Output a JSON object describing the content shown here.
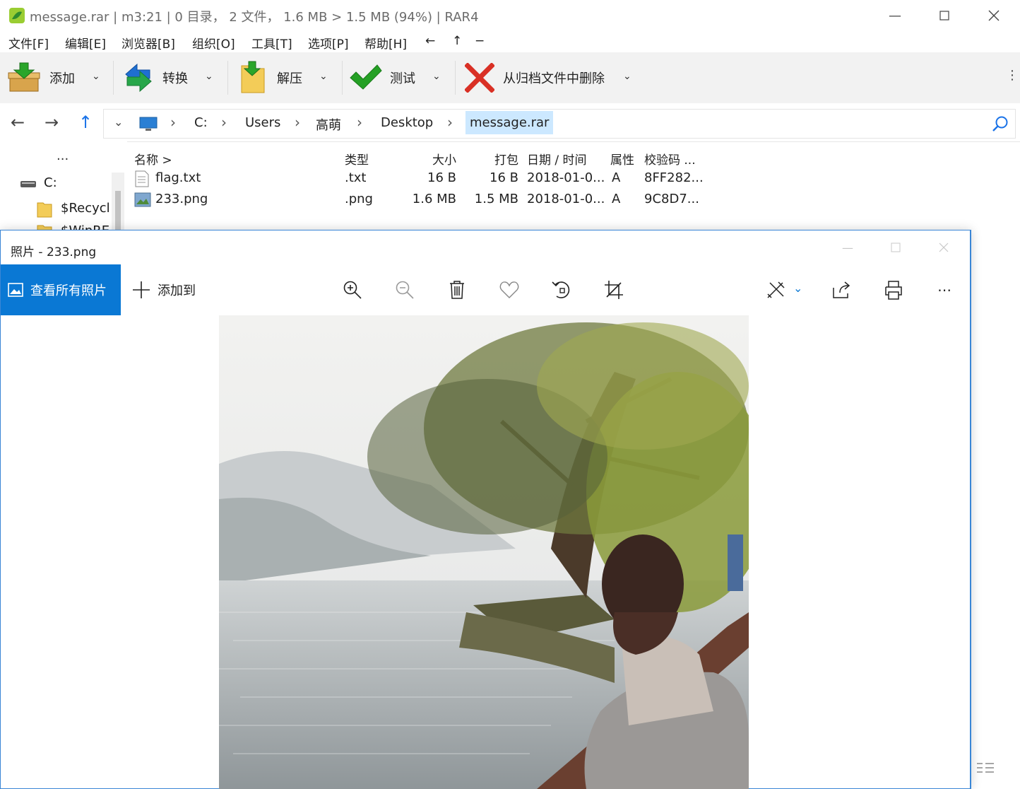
{
  "rar": {
    "title": "message.rar | m3:21 | 0 目录， 2 文件， 1.6 MB > 1.5 MB (94%) | RAR4",
    "menus": [
      "文件[F]",
      "编辑[E]",
      "浏览器[B]",
      "组织[O]",
      "工具[T]",
      "选项[P]",
      "帮助[H]"
    ],
    "menu_arrows": [
      "←",
      "↑",
      "−"
    ],
    "toolbar": {
      "add": "添加",
      "convert": "转换",
      "extract": "解压",
      "test": "测试",
      "delete": "从归档文件中删除"
    },
    "path": [
      "C:",
      "Users",
      "高萌",
      "Desktop",
      "message.rar"
    ],
    "tree": {
      "more": "...",
      "drive": "C:",
      "items": [
        "$Recycle",
        "$WinRE"
      ]
    },
    "columns": {
      "name": "名称 >",
      "type": "类型",
      "size": "大小",
      "packed": "打包",
      "date": "日期 / 时间",
      "attr": "属性",
      "checksum": "校验码 ..."
    },
    "files": [
      {
        "name": "flag.txt",
        "type": ".txt",
        "size": "16 B",
        "packed": "16 B",
        "date": "2018-01-0...",
        "attr": "A",
        "checksum": "8FF282..."
      },
      {
        "name": "233.png",
        "type": ".png",
        "size": "1.6 MB",
        "packed": "1.5 MB",
        "date": "2018-01-0...",
        "attr": "A",
        "checksum": "9C8D7..."
      }
    ]
  },
  "photos": {
    "title": "照片 - 233.png",
    "view_all": "查看所有照片",
    "add_to": "添加到"
  },
  "colors": {
    "accent_blue": "#0a78d4",
    "delete_red": "#d93025",
    "check_green": "#25a025"
  }
}
